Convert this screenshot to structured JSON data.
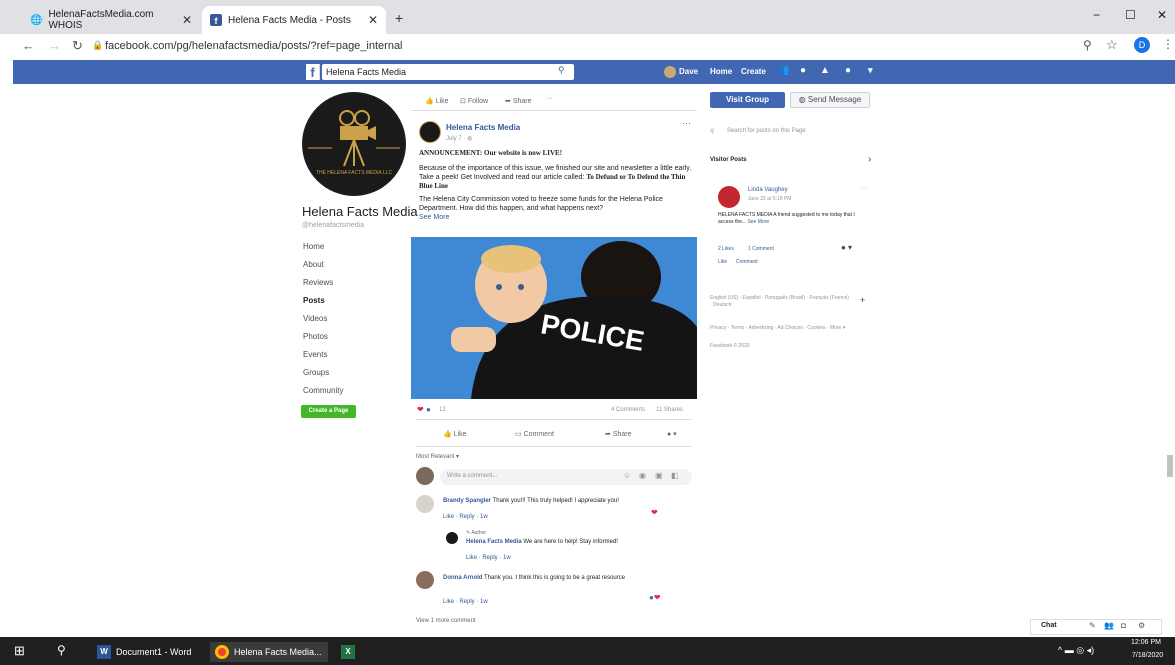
{
  "browser": {
    "tabs": [
      {
        "title": "HelenaFactsMedia.com WHOIS",
        "close": "✕"
      },
      {
        "title": "Helena Facts Media - Posts",
        "close": "✕"
      }
    ],
    "new_tab": "+",
    "url": "facebook.com/pg/helenafactsmedia/posts/?ref=page_internal",
    "window_controls": {
      "minimize": "−",
      "maximize": "☐",
      "close": "✕"
    },
    "profile_initial": "D"
  },
  "fb": {
    "search_value": "Helena Facts Media",
    "user": "Dave",
    "nav_home": "Home",
    "nav_create": "Create"
  },
  "page": {
    "name": "Helena Facts Media",
    "handle": "@helenafactsmedia",
    "nav": [
      "Home",
      "About",
      "Reviews",
      "Posts",
      "Videos",
      "Photos",
      "Events",
      "Groups",
      "Community"
    ],
    "create_page": "Create a Page",
    "like": "Like",
    "follow": "Follow",
    "share": "Share",
    "more": "···"
  },
  "post": {
    "author": "Helena Facts Media",
    "date": "July 7 · ",
    "headline": "ANNOUNCEMENT: Our website is now LIVE!",
    "body1": "Because of the importance of this issue, we finished our site and newsletter a little early. Take a peek! Get Involved and read our article called:",
    "body1_bold": "To Defund or To Defend the Thin Blue Line",
    "body2": "The Helena City Commission voted to freeze some funds for the Helena Police Department. How did this happen, and what happens next?",
    "see_more": "See More",
    "image_text": "POLICE",
    "reaction_count": "12",
    "comments_count": "4 Comments",
    "shares_count": "11 Shares",
    "action_like": "Like",
    "action_comment": "Comment",
    "action_share": "Share",
    "most_relevant": "Most Relevant ▾",
    "write_comment_placeholder": "Write a comment...",
    "view_more": "View 1 more comment"
  },
  "comments": [
    {
      "name": "Brandy Spangler",
      "text": "Thank you!!! This truly helped! I appreciate you!",
      "actions": "Like · Reply · 1w"
    },
    {
      "badge": "Author",
      "name": "Helena Facts Media",
      "text": "We are here to help! Stay informed!",
      "actions": "Like · Reply · 1w"
    },
    {
      "name": "Donna Arnold",
      "text": "Thank you. I think this is going to be a great resource",
      "actions": "Like · Reply · 1w"
    }
  ],
  "right": {
    "visit_group": "Visit Group",
    "send_message": "Send Message",
    "search_placeholder": "Search for posts on this Page",
    "visitor_posts": "Visitor Posts",
    "visitor_name": "Linda Vaughey",
    "visitor_date": "June 22 at 5:19 PM · ",
    "visitor_text": "HELENA FACTS MEDIA A friend suggested to me today that I access the...",
    "visitor_see_more": "See More",
    "visitor_likes": "2 Likes",
    "visitor_comments": "1 Comment",
    "visitor_like": "Like",
    "visitor_comment": "Comment",
    "languages": "English (US) · Español · Português (Brasil) · Français (France) · Deutsch",
    "footer": "Privacy · Terms · Advertising · Ad Choices · Cookies · More ▾",
    "copyright": "Facebook © 2020"
  },
  "chat": {
    "label": "Chat"
  },
  "taskbar": {
    "items": [
      "Document1 - Word",
      "Helena Facts Media..."
    ],
    "time": "12:06 PM",
    "date": "7/18/2020"
  },
  "colors": {
    "fb_blue": "#4267b2",
    "taskbar": "#202020",
    "create_green": "#42b72a"
  }
}
